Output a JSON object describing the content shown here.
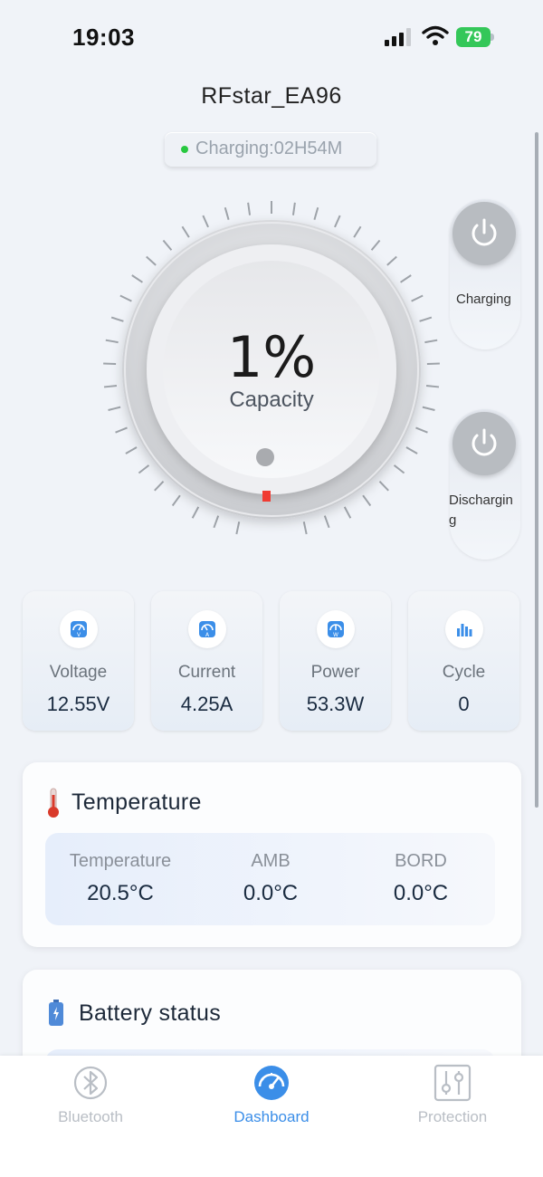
{
  "status_bar": {
    "time": "19:03",
    "battery_percent": "79"
  },
  "header": {
    "device_name": "RFstar_EA96",
    "charging_status": "Charging:02H54M"
  },
  "gauge": {
    "value": "1%",
    "label": "Capacity",
    "level_fraction": 0.01,
    "indicator_color": "#f03b32"
  },
  "toggles": [
    {
      "label": "Charging",
      "state": "off"
    },
    {
      "label": "Discharging",
      "label_line1": "Dischargin",
      "label_line2": "g",
      "state": "off"
    }
  ],
  "stats": [
    {
      "label": "Voltage",
      "value": "12.55V",
      "icon": "voltmeter-icon"
    },
    {
      "label": "Current",
      "value": "4.25A",
      "icon": "ammeter-icon"
    },
    {
      "label": "Power",
      "value": "53.3W",
      "icon": "wattmeter-icon"
    },
    {
      "label": "Cycle",
      "value": "0",
      "icon": "bar-chart-icon"
    }
  ],
  "temperature": {
    "title": "Temperature",
    "icon": "thermometer-icon",
    "columns": [
      {
        "label": "Temperature",
        "value": "20.5°C"
      },
      {
        "label": "AMB",
        "value": "0.0°C"
      },
      {
        "label": "BORD",
        "value": "0.0°C"
      }
    ]
  },
  "battery_status": {
    "title": "Battery status",
    "icon": "battery-icon"
  },
  "tabs": [
    {
      "label": "Bluetooth",
      "icon": "bluetooth-icon",
      "active": false
    },
    {
      "label": "Dashboard",
      "icon": "dashboard-icon",
      "active": true
    },
    {
      "label": "Protection",
      "icon": "sliders-icon",
      "active": false
    }
  ],
  "colors": {
    "accent": "#3b8ee8",
    "inactive_tab": "#b9bec5",
    "charging_dot": "#28c840",
    "battery_green": "#34c759"
  }
}
